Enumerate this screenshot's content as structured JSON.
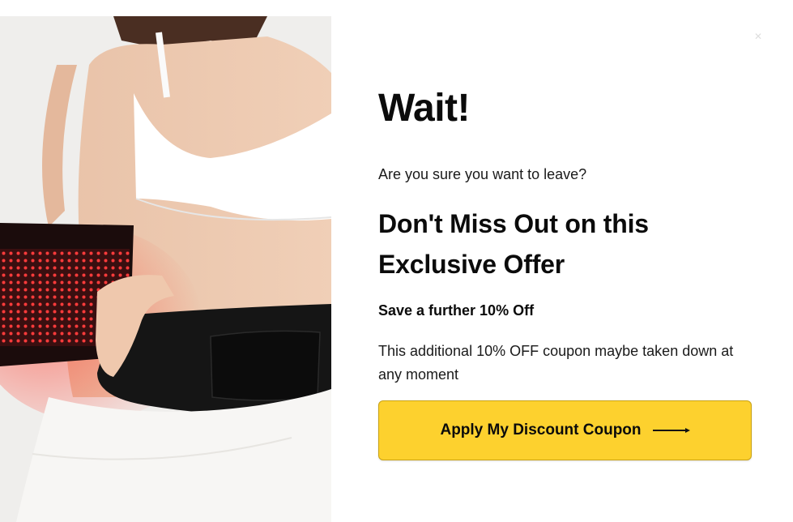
{
  "modal": {
    "title": "Wait!",
    "subtitle": "Are you sure you want to leave?",
    "headline": "Don't Miss Out on this Exclusive Offer",
    "offer": "Save a further 10% Off",
    "description": "This additional 10% OFF coupon maybe taken down at any moment",
    "cta_label": "Apply My Discount Coupon",
    "close_icon": "close-icon"
  },
  "colors": {
    "cta_background": "#fdd12e",
    "text": "#0b0b0b",
    "belt_led": "#e8252d"
  }
}
